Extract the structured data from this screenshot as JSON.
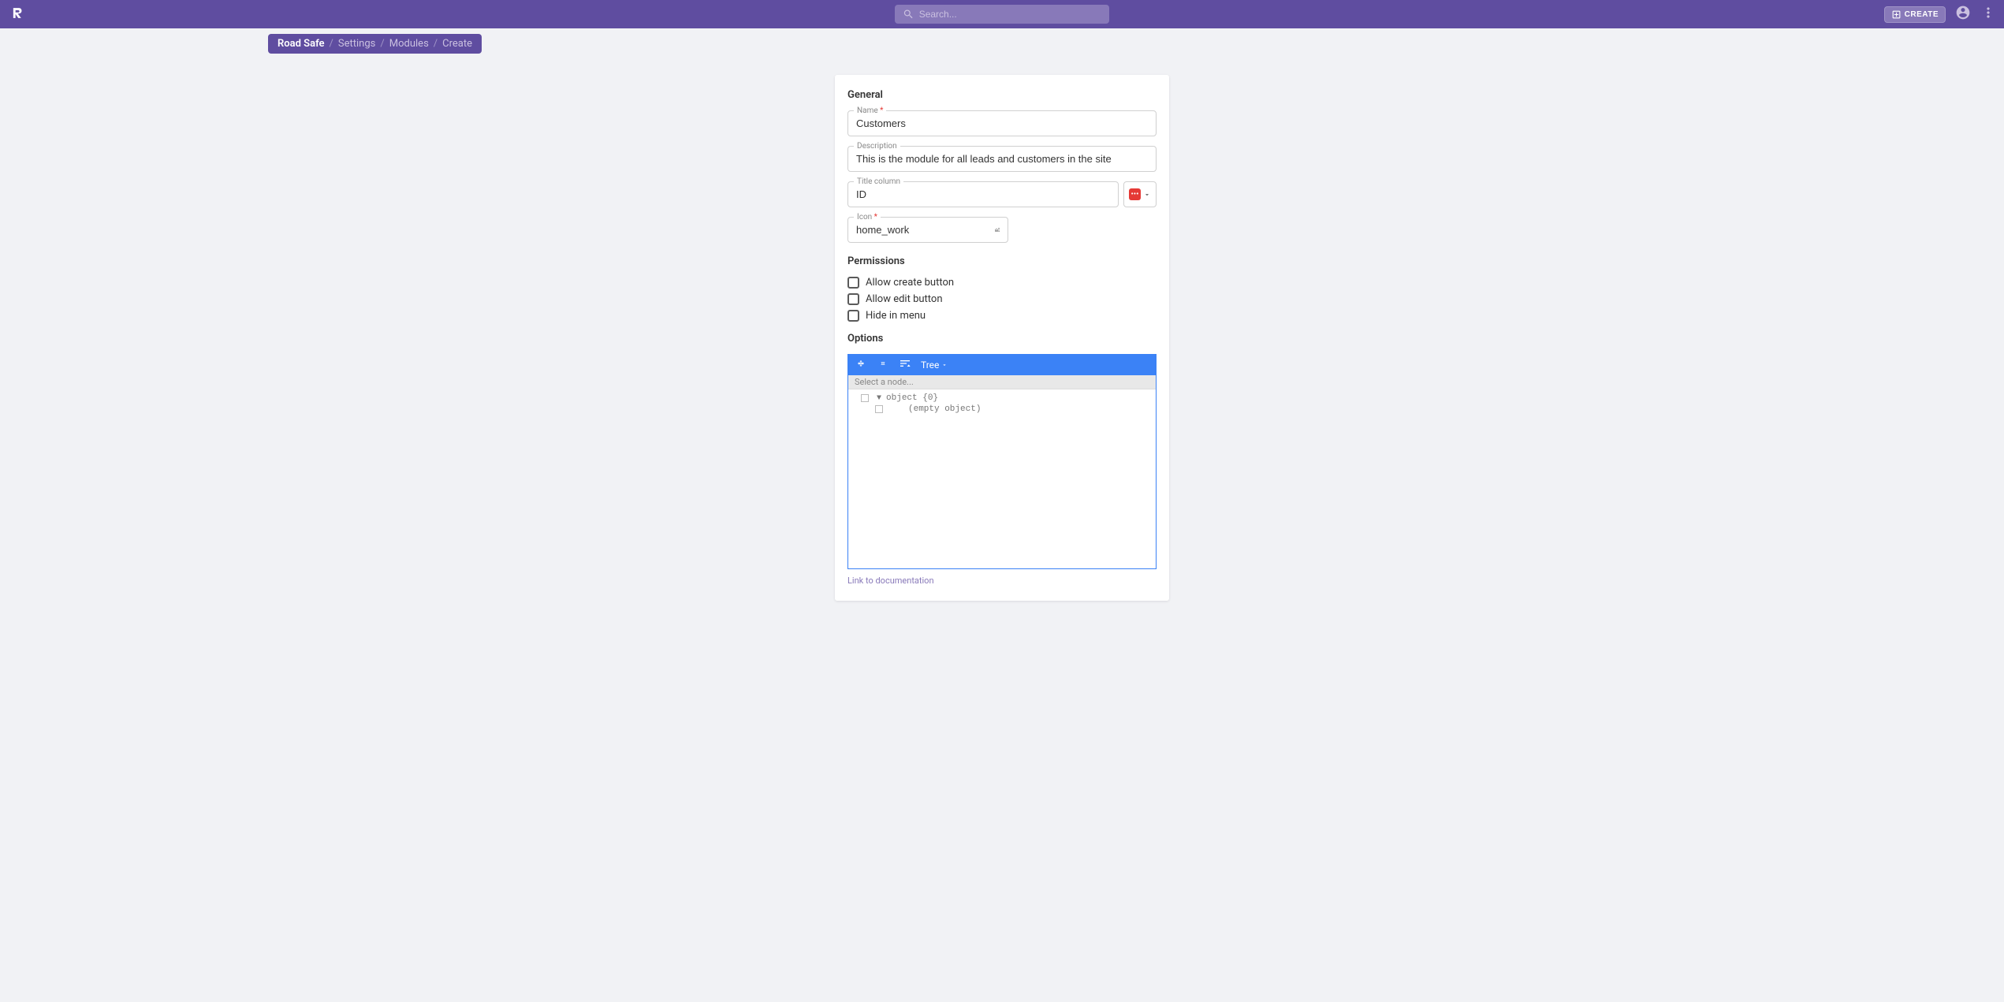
{
  "header": {
    "search_placeholder": "Search...",
    "create_label": "CREATE"
  },
  "breadcrumb": {
    "items": [
      {
        "label": "Road Safe",
        "active": true
      },
      {
        "label": "Settings",
        "active": false
      },
      {
        "label": "Modules",
        "active": false
      },
      {
        "label": "Create",
        "active": false
      }
    ]
  },
  "general": {
    "header": "General",
    "name_label": "Name",
    "name_value": "Customers",
    "description_label": "Description",
    "description_value": "This is the module for all leads and customers in the site",
    "title_column_label": "Title column",
    "title_column_value": "ID",
    "icon_label": "Icon",
    "icon_value": "home_work"
  },
  "permissions": {
    "header": "Permissions",
    "allow_create": "Allow create button",
    "allow_edit": "Allow edit button",
    "hide_menu": "Hide in menu"
  },
  "options": {
    "header": "Options",
    "tree_label": "Tree",
    "select_node_placeholder": "Select a node...",
    "object_label": "object {0}",
    "empty_label": "(empty object)",
    "doc_link": "Link to documentation"
  }
}
